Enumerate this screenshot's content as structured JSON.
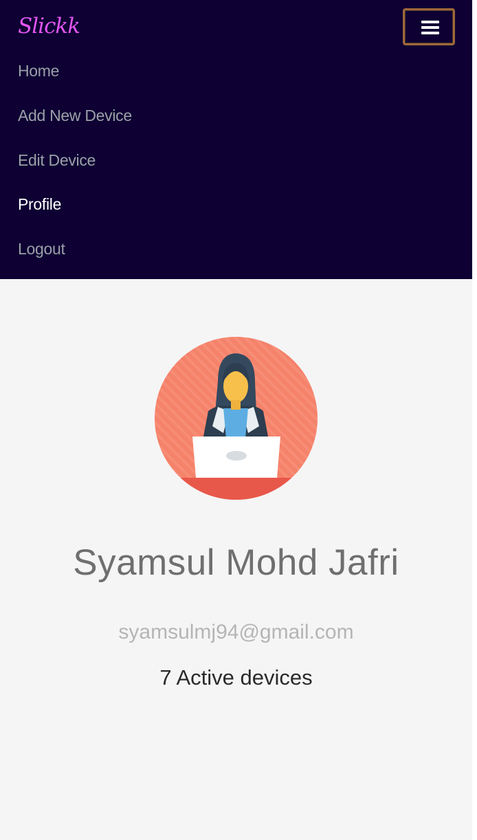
{
  "brand": {
    "name": "Slickk",
    "color": "#e256f0"
  },
  "toggle": {
    "icon": "hamburger-icon"
  },
  "nav": {
    "items": [
      {
        "label": "Home",
        "active": false
      },
      {
        "label": "Add New Device",
        "active": false
      },
      {
        "label": "Edit Device",
        "active": false
      },
      {
        "label": "Profile",
        "active": true
      },
      {
        "label": "Logout",
        "active": false
      }
    ],
    "background": "#0e0033"
  },
  "profile": {
    "avatar_icon": "woman-at-laptop-avatar-icon",
    "name": "Syamsul Mohd Jafri",
    "email": "syamsulmj94@gmail.com",
    "devices": "7 Active devices"
  }
}
